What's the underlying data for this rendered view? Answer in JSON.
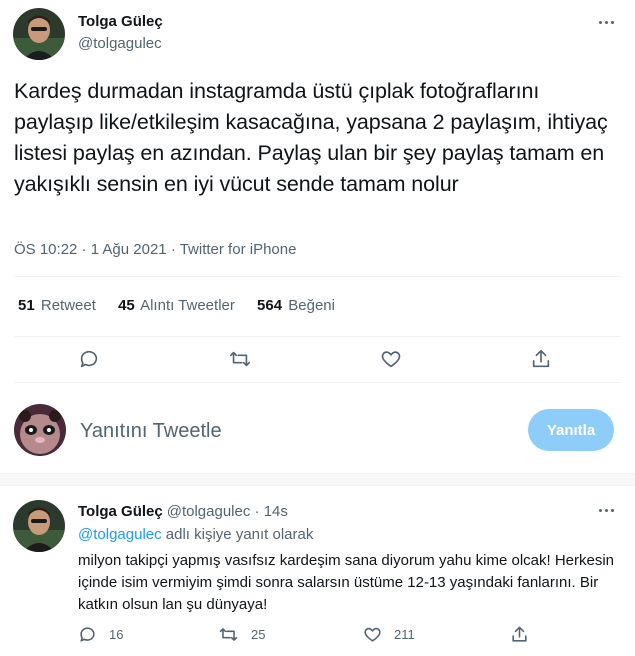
{
  "tweet": {
    "display_name": "Tolga Güleç",
    "handle": "@tolgagulec",
    "text": "Kardeş durmadan instagramda üstü çıplak fotoğraflarını paylaşıp like/etkileşim kasacağına, yapsana 2 paylaşım, ihtiyaç listesi paylaş en azından. Paylaş ulan bir şey paylaş tamam en yakışıklı sensin en iyi vücut sende tamam nolur",
    "time": "ÖS 10:22",
    "date": "1 Ağu 2021",
    "source": "Twitter for iPhone",
    "separator": " · ",
    "stats": {
      "retweets_count": "51",
      "retweets_label": "Retweet",
      "quotes_count": "45",
      "quotes_label": "Alıntı Tweetler",
      "likes_count": "564",
      "likes_label": "Beğeni"
    },
    "action_icons": [
      "reply-icon",
      "retweet-icon",
      "like-icon",
      "share-icon"
    ]
  },
  "compose": {
    "placeholder": "Yanıtını Tweetle",
    "button_label": "Yanıtla"
  },
  "reply": {
    "display_name": "Tolga Güleç",
    "handle": "@tolgagulec",
    "time": "14s",
    "separator": " · ",
    "replying_to_mention": "@tolgagulec",
    "replying_to_suffix": " adlı kişiye yanıt olarak",
    "text": "milyon takipçi yapmış vasıfsız kardeşim sana diyorum yahu kime olcak! Herkesin içinde isim vermiyim şimdi sonra salarsın üstüme 12-13 yaşındaki fanlarını. Bir katkın olsun lan şu dünyaya!",
    "replies": "16",
    "retweets": "25",
    "likes": "211"
  },
  "colors": {
    "text": "#0f1419",
    "secondary": "#536471",
    "accent": "#1d9bf0",
    "button_disabled": "#8ecdf8",
    "divider": "#eff3f4"
  }
}
